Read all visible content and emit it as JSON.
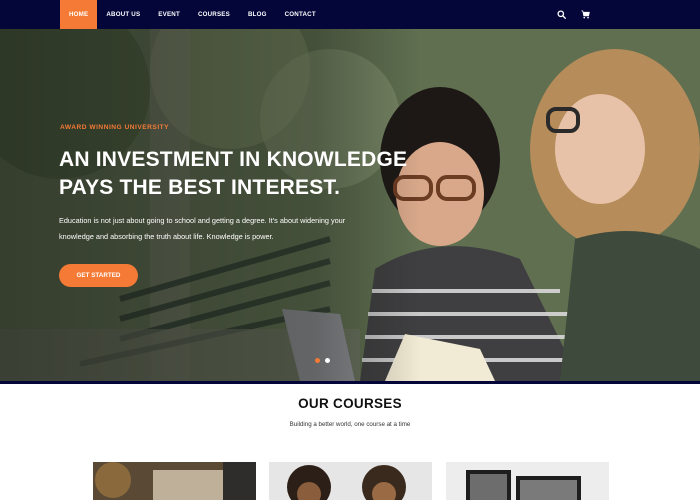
{
  "nav": {
    "items": [
      {
        "label": "HOME",
        "active": true
      },
      {
        "label": "ABOUT US",
        "active": false
      },
      {
        "label": "EVENT",
        "active": false
      },
      {
        "label": "COURSES",
        "active": false
      },
      {
        "label": "BLOG",
        "active": false
      },
      {
        "label": "CONTACT",
        "active": false
      }
    ],
    "icons": [
      "search-icon",
      "cart-icon"
    ]
  },
  "hero": {
    "kicker": "AWARD WINNING UNIVERSITY",
    "title_line1": "AN INVESTMENT IN KNOWLEDGE",
    "title_line2": "PAYS THE BEST INTEREST.",
    "text_line1": "Education is not just about going to school and getting a degree. It's about widening your",
    "text_line2": "knowledge and absorbing the truth about life. Knowledge is power.",
    "button_label": "GET STARTED",
    "slides": 2,
    "active_slide": 1
  },
  "courses": {
    "title": "OUR COURSES",
    "subtitle": "Building a better world, one course at a time"
  },
  "colors": {
    "accent": "#f47a35",
    "nav_bg": "#04063a"
  }
}
